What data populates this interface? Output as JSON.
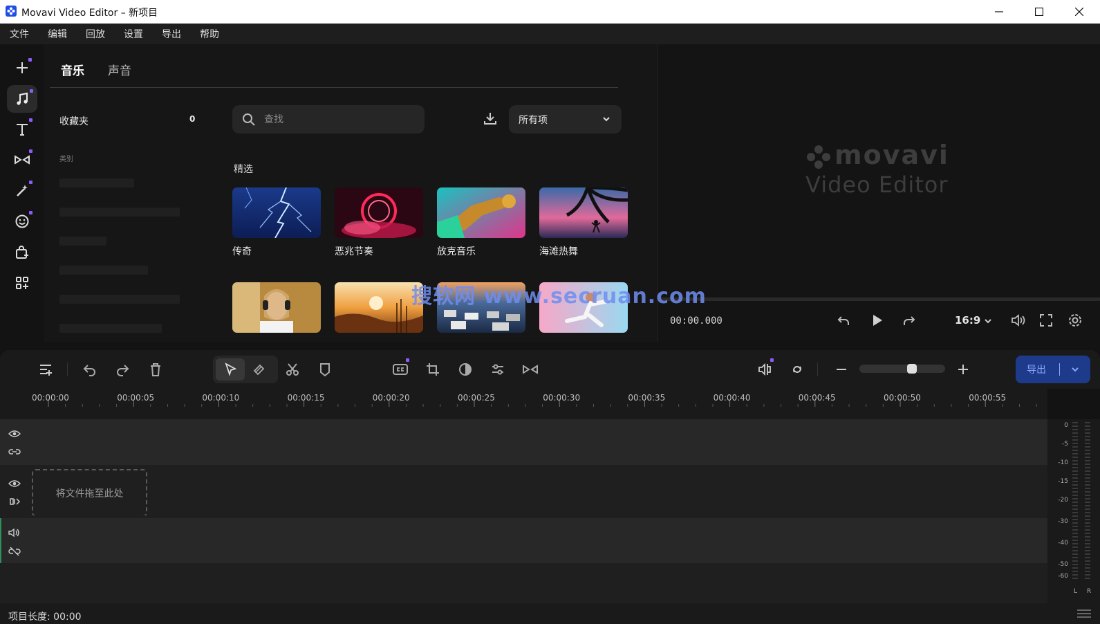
{
  "window": {
    "title": "Movavi Video Editor – 新项目"
  },
  "menu": [
    "文件",
    "编辑",
    "回放",
    "设置",
    "导出",
    "帮助"
  ],
  "rail": {
    "items": [
      "add-media",
      "music",
      "titles",
      "transitions",
      "effects",
      "stickers",
      "elements",
      "more"
    ],
    "active": "music",
    "accent_color": "#8b5cf6"
  },
  "library": {
    "tabs": [
      "音乐",
      "声音"
    ],
    "active_tab": "音乐",
    "favorites_label": "收藏夹",
    "favorites_count": "0",
    "categories_label": "类别",
    "search_placeholder": "查找",
    "filter_value": "所有项",
    "featured_label": "精选",
    "tracks": [
      {
        "title": "传奇",
        "thumb": "lightning"
      },
      {
        "title": "恶兆节奏",
        "thumb": "red-ring"
      },
      {
        "title": "放克音乐",
        "thumb": "saxophone"
      },
      {
        "title": "海滩热舞",
        "thumb": "palm-sunset"
      },
      {
        "title": "",
        "thumb": "headphones-girl"
      },
      {
        "title": "",
        "thumb": "golden-field"
      },
      {
        "title": "",
        "thumb": "traffic-road"
      },
      {
        "title": "",
        "thumb": "dancer-pink"
      }
    ]
  },
  "preview": {
    "logo_text": "movavi",
    "logo_sub": "Video Editor",
    "timecode": "00:00.000",
    "aspect_ratio": "16:9"
  },
  "timeline": {
    "export_label": "导出",
    "ruler_ticks": [
      "00:00:00",
      "00:00:05",
      "00:00:10",
      "00:00:15",
      "00:00:20",
      "00:00:25",
      "00:00:30",
      "00:00:35",
      "00:00:40",
      "00:00:45",
      "00:00:50",
      "00:00:55"
    ],
    "drop_zone_label": "将文件拖至此处",
    "zoom_level": 0.63,
    "export_color": "#1e3a8a"
  },
  "meter": {
    "db_labels": [
      "0",
      "-5",
      "-10",
      "-15",
      "-20",
      "-30",
      "-40",
      "-50",
      "-60"
    ],
    "channels": [
      "L",
      "R"
    ]
  },
  "status": {
    "project_length": "项目长度: 00:00"
  },
  "watermark": "搜软网 www.secruan.com"
}
